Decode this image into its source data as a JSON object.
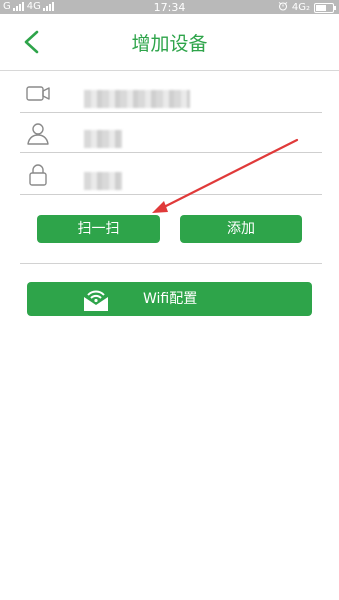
{
  "status_bar": {
    "carrier1": "G",
    "carrier2": "4G",
    "time": "17:34",
    "network_right": "4G₂"
  },
  "header": {
    "title": "增加设备"
  },
  "form": {
    "device_id_value": "",
    "username_value": "",
    "password_value": ""
  },
  "buttons": {
    "scan_label": "扫一扫",
    "add_label": "添加",
    "wifi_label": "Wifi配置"
  },
  "colors": {
    "brand": "#2ea44a",
    "arrow": "#e03a3a"
  },
  "icons": {
    "back": "chevron-left-icon",
    "camera": "video-camera-icon",
    "user": "user-icon",
    "lock": "lock-icon",
    "wifi": "wifi-envelope-icon"
  }
}
